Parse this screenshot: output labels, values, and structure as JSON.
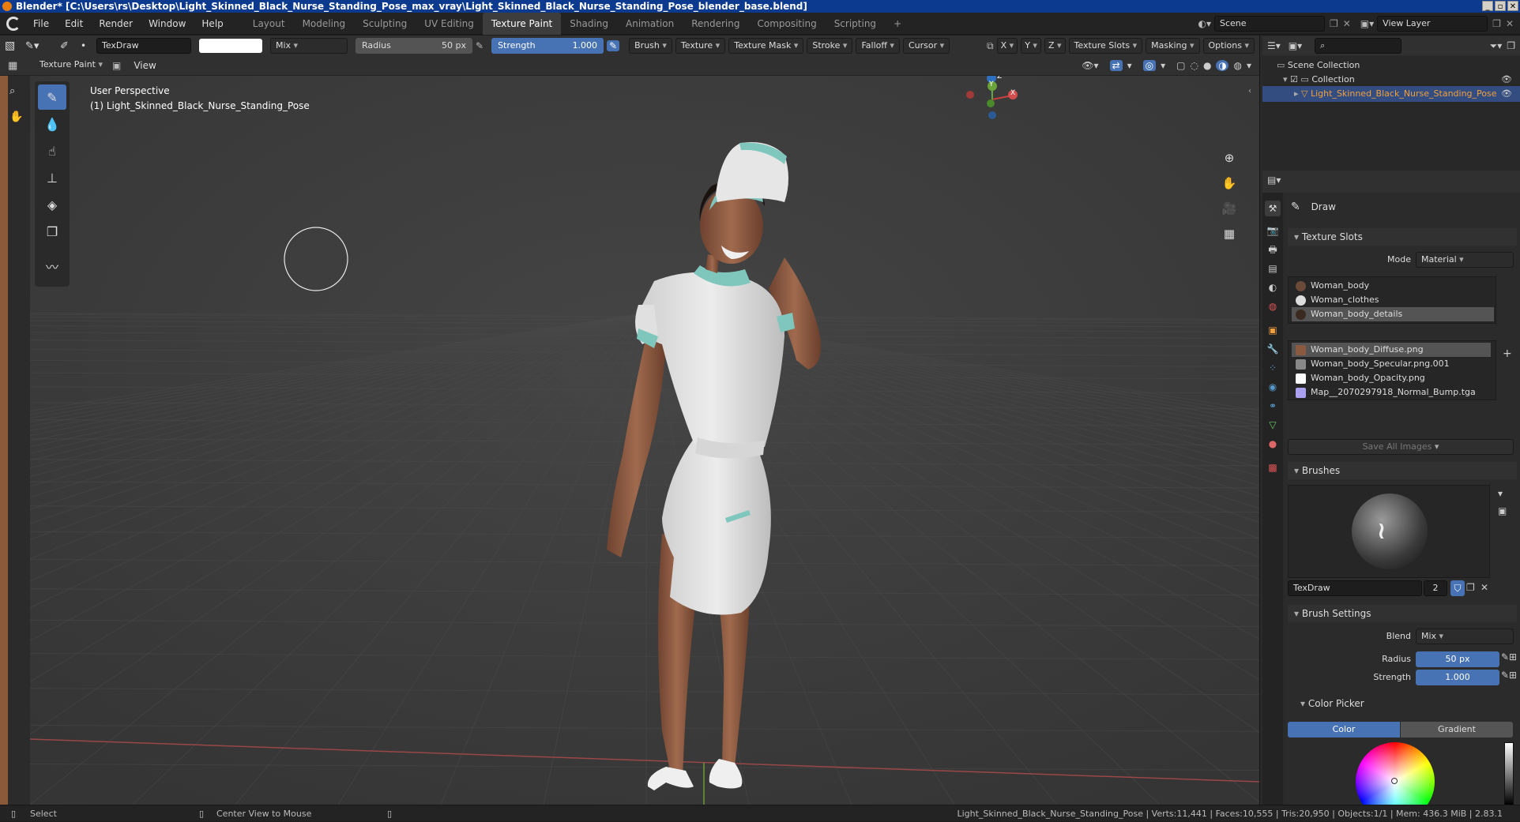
{
  "titlebar": {
    "title": "Blender* [C:\\Users\\rs\\Desktop\\Light_Skinned_Black_Nurse_Standing_Pose_max_vray\\Light_Skinned_Black_Nurse_Standing_Pose_blender_base.blend]"
  },
  "menus": [
    "File",
    "Edit",
    "Render",
    "Window",
    "Help"
  ],
  "workspaces": [
    "Layout",
    "Modeling",
    "Sculpting",
    "UV Editing",
    "Texture Paint",
    "Shading",
    "Animation",
    "Rendering",
    "Compositing",
    "Scripting"
  ],
  "active_workspace": "Texture Paint",
  "scene": {
    "name": "Scene",
    "view_layer": "View Layer"
  },
  "tool_header": {
    "brush_name": "TexDraw",
    "blend": "Mix",
    "radius_label": "Radius",
    "radius_value": "50 px",
    "strength_label": "Strength",
    "strength_value": "1.000",
    "menus": [
      "Brush",
      "Texture",
      "Texture Mask",
      "Stroke",
      "Falloff",
      "Cursor"
    ],
    "axes": [
      "X",
      "Y",
      "Z"
    ],
    "right_menus": [
      "Texture Slots",
      "Masking",
      "Options"
    ]
  },
  "mode_header": {
    "mode": "Texture Paint",
    "view": "View"
  },
  "viewport": {
    "perspective": "User Perspective",
    "object": "(1) Light_Skinned_Black_Nurse_Standing_Pose",
    "gizmo": {
      "x": "X",
      "y": "Y",
      "z": "Z"
    }
  },
  "outliner": {
    "scene_collection": "Scene Collection",
    "collection": "Collection",
    "object": "Light_Skinned_Black_Nurse_Standing_Pose"
  },
  "properties": {
    "tool": "Draw",
    "texture_slots": {
      "title": "Texture Slots",
      "mode_label": "Mode",
      "mode_value": "Material",
      "materials": [
        "Woman_body",
        "Woman_clothes",
        "Woman_body_details"
      ],
      "images": [
        "Woman_body_Diffuse.png",
        "Woman_body_Specular.png.001",
        "Woman_body_Opacity.png",
        "Map__2070297918_Normal_Bump.tga"
      ],
      "save_all": "Save All Images"
    },
    "brushes": {
      "title": "Brushes",
      "name": "TexDraw",
      "users": "2"
    },
    "brush_settings": {
      "title": "Brush Settings",
      "blend_label": "Blend",
      "blend_value": "Mix",
      "radius_label": "Radius",
      "radius_value": "50 px",
      "strength_label": "Strength",
      "strength_value": "1.000"
    },
    "color_picker": {
      "title": "Color Picker",
      "tab_color": "Color",
      "tab_gradient": "Gradient"
    }
  },
  "statusbar": {
    "select": "Select",
    "center_view": "Center View to Mouse",
    "stats": "Light_Skinned_Black_Nurse_Standing_Pose | Verts:11,441 | Faces:10,555 | Tris:20,950 | Objects:1/1 | Mem: 436.3 MiB | 2.83.1"
  },
  "colors": {
    "accent": "#4772b3",
    "title_bar": "#0c3a8e",
    "selection": "#334d80"
  }
}
